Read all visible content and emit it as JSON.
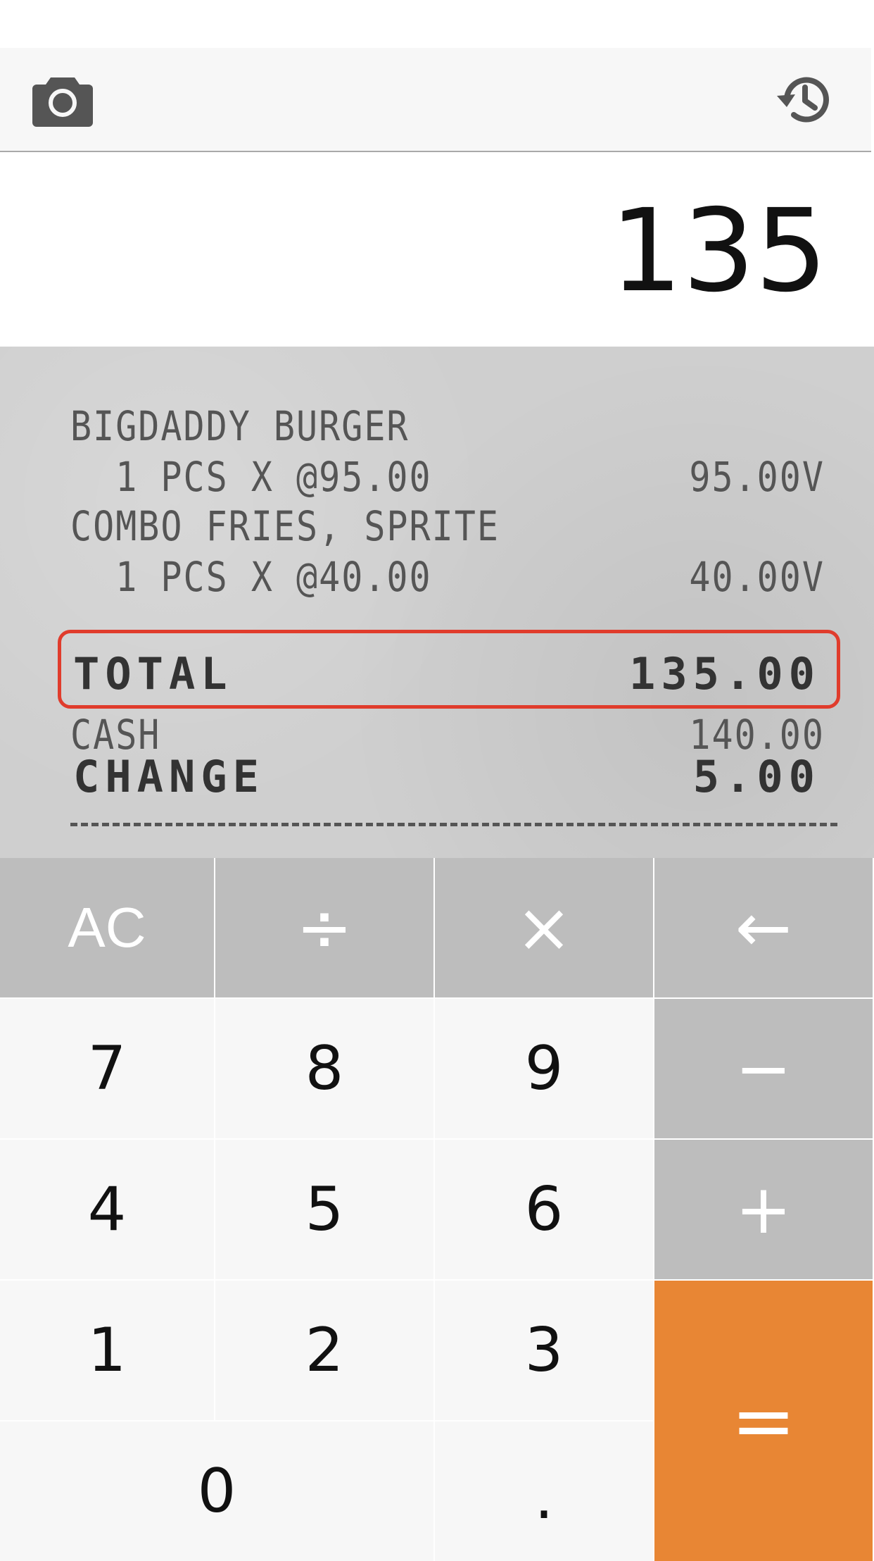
{
  "toolbar": {
    "camera_icon": "camera-icon",
    "history_icon": "history-icon"
  },
  "display": {
    "value": "135"
  },
  "receipt": {
    "lines": [
      {
        "label": "BIGDADDY BURGER",
        "amount": ""
      },
      {
        "label": "  1 PCS X @95.00",
        "amount": "95.00V"
      },
      {
        "label": "COMBO FRIES, SPRITE",
        "amount": ""
      },
      {
        "label": "  1 PCS X @40.00",
        "amount": "40.00V"
      }
    ],
    "total_label": "TOTAL",
    "total_amount": "135.00",
    "cash_label": "CASH",
    "cash_amount": "140.00",
    "change_label": "CHANGE",
    "change_amount": "5.00",
    "highlight_color": "#e03c2c"
  },
  "keypad": {
    "ac": "AC",
    "divide": "÷",
    "multiply": "×",
    "backspace": "←",
    "seven": "7",
    "eight": "8",
    "nine": "9",
    "minus": "−",
    "four": "4",
    "five": "5",
    "six": "6",
    "plus": "+",
    "one": "1",
    "two": "2",
    "three": "3",
    "equals": "=",
    "zero": "0",
    "dot": "."
  },
  "colors": {
    "operator_key": "#bdbdbd",
    "equals_key": "#e88634",
    "digit_key": "#f7f7f7"
  }
}
